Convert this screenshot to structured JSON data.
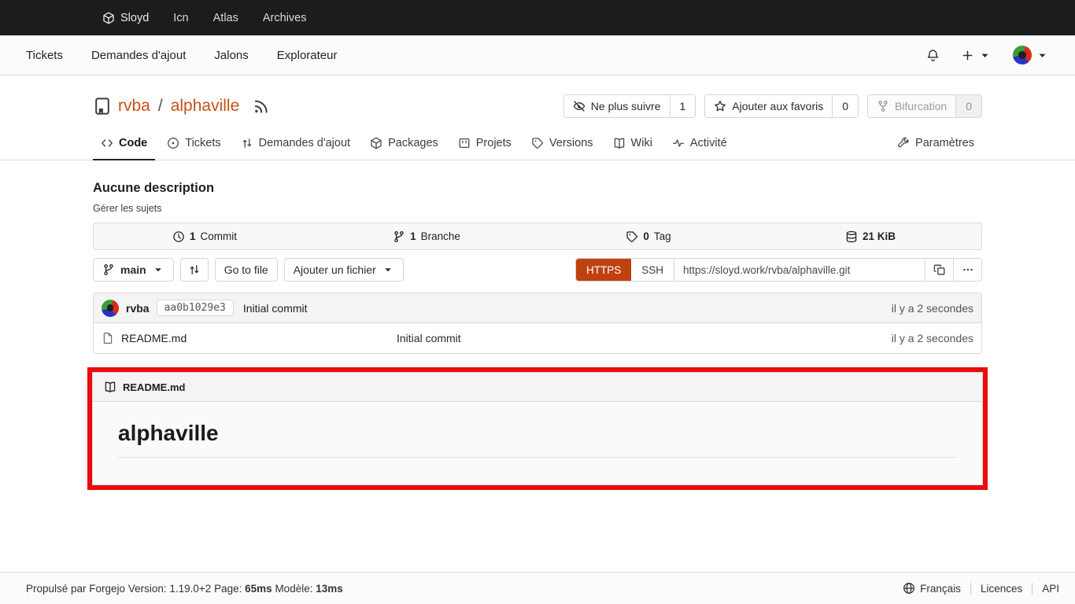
{
  "colors": {
    "primary_button": "#bf4112",
    "repo_link": "#c75017",
    "meta_nav_bg": "#1b1c1d",
    "annotation_border": "#ea0b0b"
  },
  "meta_nav": {
    "brand": "Sloyd",
    "items": [
      "Icn",
      "Atlas",
      "Archives"
    ]
  },
  "top_nav": {
    "items": [
      "Tickets",
      "Demandes d'ajout",
      "Jalons",
      "Explorateur"
    ]
  },
  "repo": {
    "owner": "rvba",
    "sep": "/",
    "name": "alphaville"
  },
  "repo_actions": {
    "unwatch": {
      "label": "Ne plus suivre",
      "count": "1"
    },
    "star": {
      "label": "Ajouter aux favoris",
      "count": "0"
    },
    "fork": {
      "label": "Bifurcation",
      "count": "0"
    }
  },
  "tabs": {
    "code": "Code",
    "issues": "Tickets",
    "pulls": "Demandes d'ajout",
    "packages": "Packages",
    "projects": "Projets",
    "releases": "Versions",
    "wiki": "Wiki",
    "activity": "Activité",
    "settings": "Paramètres"
  },
  "overview": {
    "description": "Aucune description",
    "manage_topics": "Gérer les sujets"
  },
  "stats": {
    "commits": {
      "count": "1",
      "label": "Commit"
    },
    "branches": {
      "count": "1",
      "label": "Branche"
    },
    "tags": {
      "count": "0",
      "label": "Tag"
    },
    "size": {
      "value": "21 KiB"
    }
  },
  "toolbar": {
    "branch": "main",
    "goto_file": "Go to file",
    "add_file": "Ajouter un fichier",
    "clone_https": "HTTPS",
    "clone_ssh": "SSH",
    "clone_url": "https://sloyd.work/rvba/alphaville.git"
  },
  "latest_commit": {
    "author": "rvba",
    "sha": "aa0b1029e3",
    "message": "Initial commit",
    "time": "il y a 2 secondes"
  },
  "files": [
    {
      "name": "README.md",
      "message": "Initial commit",
      "time": "il y a 2 secondes"
    }
  ],
  "readme": {
    "title": "README.md",
    "heading": "alphaville"
  },
  "footer": {
    "powered": "Propulsé par Forgejo",
    "version_label": "Version:",
    "version": "1.19.0+2",
    "page_label": "Page:",
    "page_time": "65ms",
    "template_label": "Modèle:",
    "template_time": "13ms",
    "language": "Français",
    "licenses": "Licences",
    "api": "API"
  }
}
